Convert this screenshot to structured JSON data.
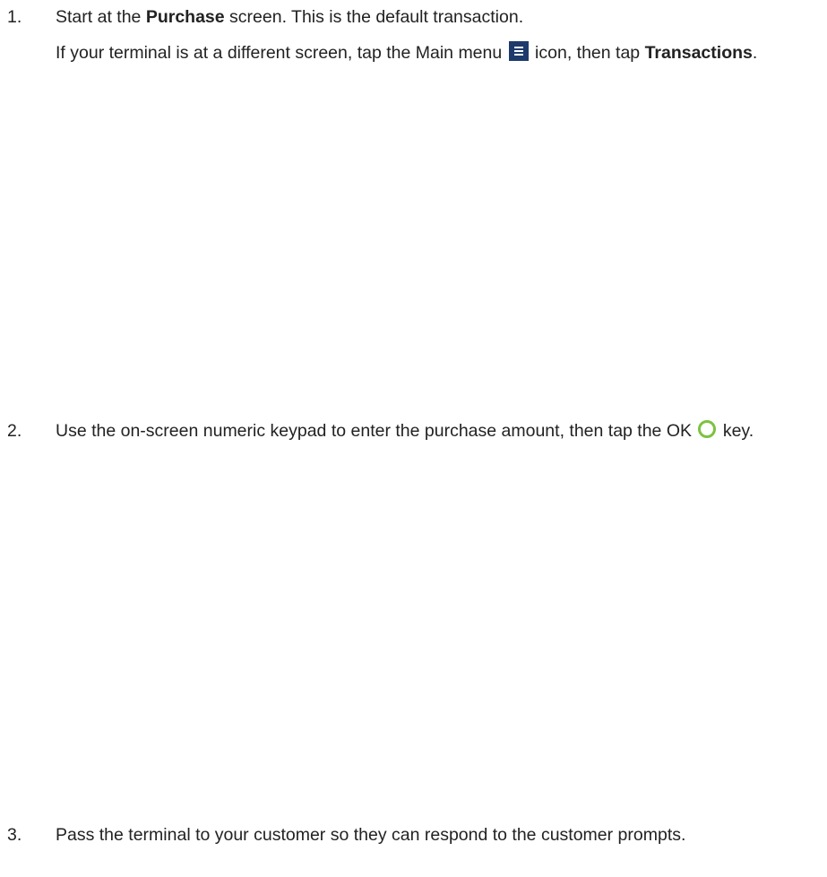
{
  "steps": [
    {
      "number": "1.",
      "para1": {
        "t1": "Start at the ",
        "b1": "Purchase",
        "t2": " screen. This is the default transaction."
      },
      "para2": {
        "t1": "If your terminal is at a different screen, tap the Main menu ",
        "icon": "menu-icon",
        "t2": " icon, then tap ",
        "b1": "Transactions",
        "t3": "."
      }
    },
    {
      "number": "2.",
      "para1": {
        "t1": "Use the on-screen numeric keypad to enter the purchase amount, then tap the OK ",
        "icon": "ok-circle-icon",
        "t2": " key."
      }
    },
    {
      "number": "3.",
      "para1": {
        "t1": "Pass the terminal to your customer so they can respond to the customer prompts."
      }
    }
  ],
  "colors": {
    "menu_icon_bg": "#1d3a6b",
    "ok_icon": "#7cc242",
    "text": "#222222"
  }
}
